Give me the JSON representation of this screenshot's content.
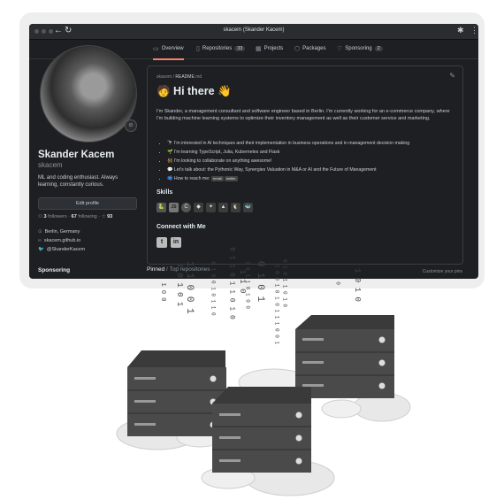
{
  "window": {
    "title": "skacem (Skander Kacem)"
  },
  "tabs": [
    {
      "label": "Overview",
      "icon": "book-icon",
      "active": true
    },
    {
      "label": "Repositories",
      "icon": "repo-icon",
      "count": "33"
    },
    {
      "label": "Projects",
      "icon": "table-icon"
    },
    {
      "label": "Packages",
      "icon": "package-icon"
    },
    {
      "label": "Sponsoring",
      "icon": "heart-icon",
      "count": "2"
    }
  ],
  "profile": {
    "name": "Skander Kacem",
    "login": "skacem",
    "bio": "ML and coding enthusiast. Always learning, constantly curious.",
    "edit_label": "Edit profile",
    "followers_count": "3",
    "followers_label": "followers",
    "following_count": "67",
    "following_label": "following",
    "stars_count": "93",
    "location": "Berlin, Germany",
    "website": "skacem.github.io",
    "twitter": "@SkanderKacem"
  },
  "sidebar": {
    "sponsoring_heading": "Sponsoring"
  },
  "readme": {
    "breadcrumb_user": "skacem",
    "breadcrumb_sep": " / ",
    "breadcrumb_file": "README",
    "breadcrumb_ext": ".md",
    "heading": "🧑 Hi there 👋",
    "intro": "I'm Skander, a management consultant and software engineer based in Berlin. I'm currently working for an e-commerce company, where I'm building machine learning systems to optimize their inventory management as well as their customer service and marketing.",
    "bullets": [
      "🔭 I'm interested in AI techniques and their implementation in business operations and in management decision making",
      "🌱 I'm learning TypeScript, Julia, Kubernetes and Flask",
      "👯 I'm looking to collaborate on anything awesome!",
      "💬 Let's talk about: the Pythonic Way, Synergies Valuation in M&A or AI and the Future of Management",
      "📫 How to reach me:"
    ],
    "reach_badges": [
      "email",
      "twitter"
    ],
    "skills_heading": "Skills",
    "skills": [
      "python-icon",
      "javascript-icon",
      "c-plus-plus-icon",
      "git-icon",
      "sklearn-icon",
      "tensorflow-icon",
      "linux-icon",
      "docker-icon"
    ],
    "connect_heading": "Connect with Me",
    "social": [
      "twitter-icon",
      "linkedin-icon"
    ]
  },
  "pinned": {
    "label": "Pinned",
    "sep": " / ",
    "top_label": "Top repositories",
    "customize": "Customize your pins"
  },
  "binary_streams": [
    "1 0 0",
    "1 0 1 0 1",
    "1 1 0 0 1",
    "0 1 0 0 1 0 1 1 0",
    "0 1 1 0 1 1 0 1 0",
    "1 0 1 1 0 1 0 0",
    "0 1 0 1",
    "1 1 0",
    "1 0 0 1 0 1 0 1 1 1 0 0 1",
    "0 1 0 1 1 0 1 0",
    "0",
    "1 0 1 0"
  ]
}
